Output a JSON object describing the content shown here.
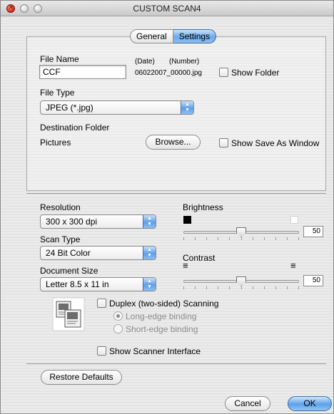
{
  "window": {
    "title": "CUSTOM SCAN4"
  },
  "tabs": [
    {
      "label": "General"
    },
    {
      "label": "Settings"
    }
  ],
  "file_name": {
    "label": "File Name",
    "value": "CCF",
    "date_header": "(Date)",
    "number_header": "(Number)",
    "generated_name": "06022007_00000.jpg",
    "show_folder_label": "Show Folder"
  },
  "file_type": {
    "label": "File Type",
    "selected": "JPEG (*.jpg)"
  },
  "destination": {
    "label": "Destination Folder",
    "folder": "Pictures",
    "browse_label": "Browse...",
    "show_save_as_label": "Show Save As Window"
  },
  "resolution": {
    "label": "Resolution",
    "selected": "300 x 300 dpi"
  },
  "scan_type": {
    "label": "Scan Type",
    "selected": "24 Bit Color"
  },
  "document_size": {
    "label": "Document Size",
    "selected": "Letter  8.5 x 11 in"
  },
  "brightness": {
    "label": "Brightness",
    "value": "50",
    "level_fraction": 0.5
  },
  "contrast": {
    "label": "Contrast",
    "value": "50",
    "level_fraction": 0.5
  },
  "duplex": {
    "label": "Duplex (two-sided) Scanning",
    "long_edge": "Long-edge binding",
    "short_edge": "Short-edge binding"
  },
  "show_scanner_interface_label": "Show Scanner Interface",
  "buttons": {
    "restore": "Restore Defaults",
    "cancel": "Cancel",
    "ok": "OK"
  },
  "colors": {
    "accent": "#6ea8e8",
    "accent_dark": "#416f9e"
  }
}
